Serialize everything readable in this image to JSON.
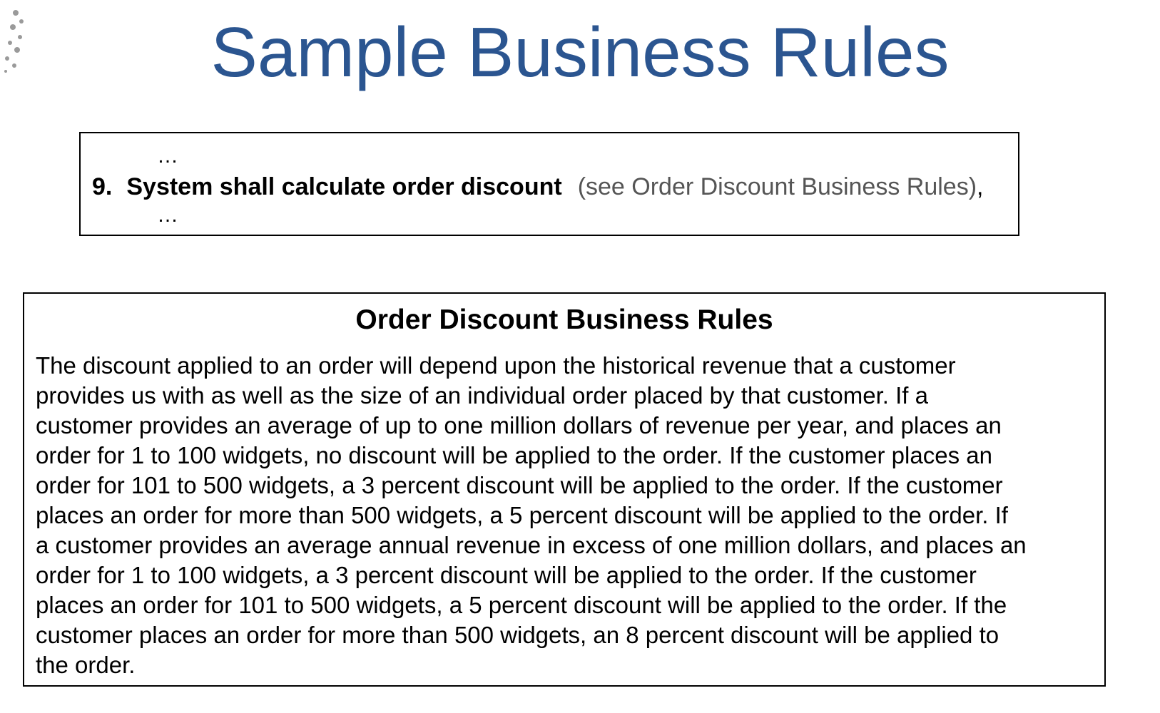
{
  "slide": {
    "title": "Sample Business Rules"
  },
  "requirement": {
    "ellipsis_top": "…",
    "number": "9.",
    "text": "System shall calculate order discount",
    "reference": "(see Order Discount Business Rules)",
    "trailing": ",",
    "ellipsis_bottom": "…"
  },
  "rules": {
    "heading": "Order Discount Business Rules",
    "body": "The discount applied to an order will depend upon the historical revenue that a customer\nprovides us with as well as the size of an individual order placed by that customer.  If a\ncustomer provides an average of up to one million dollars of revenue per year, and places an\norder for 1 to 100 widgets, no discount will be applied to the order.  If the customer places an\norder for 101 to 500 widgets, a 3 percent discount will be applied to the order.  If the customer\nplaces an order for more than 500 widgets, a 5 percent discount will be applied to the order.  If\na customer provides an average annual revenue in excess of one million dollars, and places an\norder for 1 to 100 widgets, a 3 percent discount will be applied to the order.  If the customer\nplaces an order for 101 to 500 widgets, a 5 percent discount will be applied to the order.  If the\ncustomer places an order for more than 500 widgets, an 8 percent discount will be applied to\nthe order."
  },
  "colors": {
    "title": "#2b5590",
    "reference_text": "#555555",
    "border": "#000000"
  }
}
